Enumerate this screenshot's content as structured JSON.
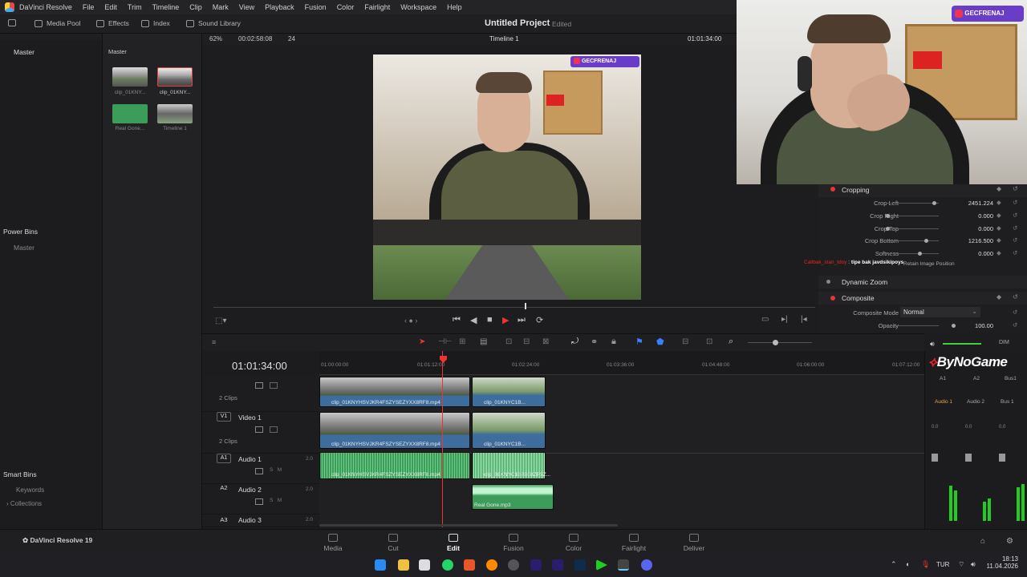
{
  "app": {
    "name": "DaVinci Resolve",
    "version_label": "DaVinci Resolve 19"
  },
  "menu": [
    "DaVinci Resolve",
    "File",
    "Edit",
    "Trim",
    "Timeline",
    "Clip",
    "Mark",
    "View",
    "Playback",
    "Fusion",
    "Color",
    "Fairlight",
    "Workspace",
    "Help"
  ],
  "toolbar": {
    "media_pool": "Media Pool",
    "effects": "Effects",
    "index": "Index",
    "sound_library": "Sound Library"
  },
  "project": {
    "title": "Untitled Project",
    "status": "Edited"
  },
  "left_panel": {
    "master": "Master",
    "power_bins": "Power Bins",
    "power_master": "Master",
    "smart_bins": "Smart Bins",
    "keywords": "Keywords",
    "collections": "Collections"
  },
  "media_pool": {
    "header": "Master",
    "clips": [
      {
        "name": "clip_01KNY...",
        "color": "#7a8a72"
      },
      {
        "name": "clip_01KNY...",
        "color": "#6a7a78"
      },
      {
        "name": "Real Gone...",
        "color": "#3c9c5a"
      },
      {
        "name": "Timeline 1",
        "color": "#556"
      }
    ]
  },
  "viewer": {
    "zoom": "62%",
    "duration": "00:02:58:08",
    "fps": "24",
    "timeline_name": "Timeline 1",
    "timecode": "01:01:34:00",
    "overlay_handle": "GECFRENAJ"
  },
  "timeline": {
    "current_timecode": "01:01:34:00",
    "ruler": [
      "01:00:00:00",
      "01:01:12:00",
      "01:02:24:00",
      "01:03:36:00",
      "01:04:48:00",
      "01:06:00:00",
      "01:07:12:00"
    ],
    "tracks": [
      {
        "id": "",
        "name": "",
        "clips_count": "2 Clips"
      },
      {
        "id": "V1",
        "name": "Video 1",
        "clips_count": "2 Clips"
      },
      {
        "id": "A1",
        "name": "Audio 1",
        "level": "2.0"
      },
      {
        "id": "A2",
        "name": "Audio 2",
        "level": "2.0"
      },
      {
        "id": "A3",
        "name": "Audio 3",
        "level": "2.0"
      }
    ],
    "clips": {
      "v2a": "clip_01KNYHSVJKR4FSZYSEZYXX8RF8.mp4",
      "v2b": "clip_01KNYC1B...",
      "v1a": "clip_01KNYHSVJKR4FSZYSEZYXX8RF8.mp4",
      "v1b": "clip_01KNYC1B...",
      "a1a": "clip_01KNYHSVJKR4FSZYSEZYXX8RF8.mp4",
      "a1b": "clip_01KNYC1B6B08ZP5Z...",
      "a2": "Real Gone.mp3"
    }
  },
  "inspector": {
    "cropping": "Cropping",
    "rows": [
      {
        "label": "Crop Left",
        "value": "2451.224",
        "pos": 0.88
      },
      {
        "label": "Crop Right",
        "value": "0.000",
        "pos": 0.0
      },
      {
        "label": "Crop Top",
        "value": "0.000",
        "pos": 0.0
      },
      {
        "label": "Crop Bottom",
        "value": "1216.500",
        "pos": 0.72
      },
      {
        "label": "Softness",
        "value": "0.000",
        "pos": 0.62
      }
    ],
    "chat_user": "Callbak_stan_tdoy",
    "chat_msg": "tipe bak javdsikipoys",
    "image_position": "Retain Image Position",
    "dynamic_zoom": "Dynamic Zoom",
    "composite": "Composite",
    "composite_mode_label": "Composite Mode",
    "composite_mode_value": "Normal",
    "opacity_label": "Opacity",
    "opacity_value": "100.00"
  },
  "webcam": {
    "handle": "GECFRENAJ"
  },
  "mixer": {
    "dim": "DIM",
    "channels": [
      "A1",
      "A2",
      "Bus1"
    ],
    "channel_names": [
      "Audio 1",
      "Audio 2",
      "Bus 1"
    ],
    "watermark": "ByNoGame",
    "levels": [
      "0.0",
      "0.0",
      "0.0"
    ]
  },
  "pages": [
    "Media",
    "Cut",
    "Edit",
    "Fusion",
    "Color",
    "Fairlight",
    "Deliver"
  ],
  "active_page": "Edit",
  "taskbar": {
    "lang": "TUR",
    "time": "18:13",
    "date": "11.04.2026"
  }
}
